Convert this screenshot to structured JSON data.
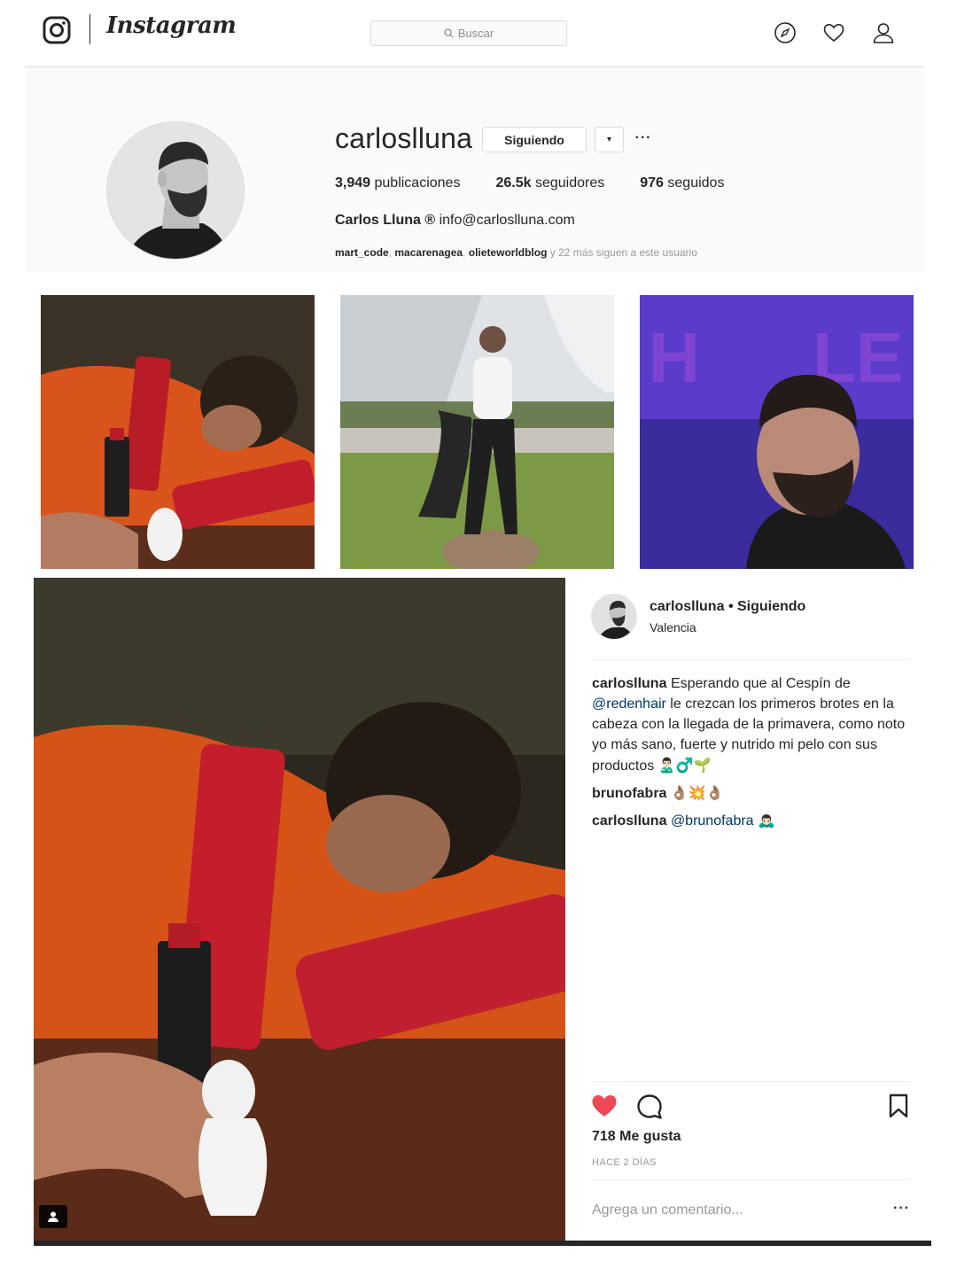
{
  "nav": {
    "logo_text": "Instagram",
    "search_placeholder": "Buscar",
    "icons": [
      "instagram-glyph-icon",
      "compass-icon",
      "heart-icon",
      "user-icon"
    ]
  },
  "profile": {
    "username": "carloslluna",
    "follow_button": "Siguiendo",
    "dropdown_symbol": "▾",
    "more_symbol": "···",
    "stats": {
      "posts_count": "3,949",
      "posts_label": "publicaciones",
      "followers_count": "26.5k",
      "followers_label": "seguidores",
      "following_count": "976",
      "following_label": "seguidos"
    },
    "full_name": "Carlos Lluna ®",
    "bio_email": "info@carloslluna.com",
    "followed_by_names": [
      "mart_code",
      "macarenagea",
      "olieteworldblog"
    ],
    "followed_by_suffix": "y 22 más siguen a este usuario"
  },
  "post": {
    "user": "carloslluna",
    "separator": "•",
    "follow_state": "Siguiendo",
    "location": "Valencia",
    "caption_user": "carloslluna",
    "caption_before": "Esperando que al Cespín de",
    "caption_mention": "@redenhair",
    "caption_after": "le crezcan los primeros brotes en la cabeza con la llegada de la primavera, como noto yo más sano, fuerte y nutrido mi pelo con sus productos",
    "caption_emoji": "🙎🏻‍♂️♂️🌱",
    "comment1_user": "brunofabra",
    "comment1_emoji": "👌🏽💥👌🏽",
    "comment2_user": "carloslluna",
    "comment2_mention": "@brunofabra",
    "comment2_emoji": "🙇🏻‍♂️",
    "likes": "718 Me gusta",
    "time_ago": "HACE 2 DÍAS",
    "comment_placeholder": "Agrega un comentario...",
    "options_symbol": "···",
    "liked": true,
    "heart_color": "#ed4956"
  }
}
